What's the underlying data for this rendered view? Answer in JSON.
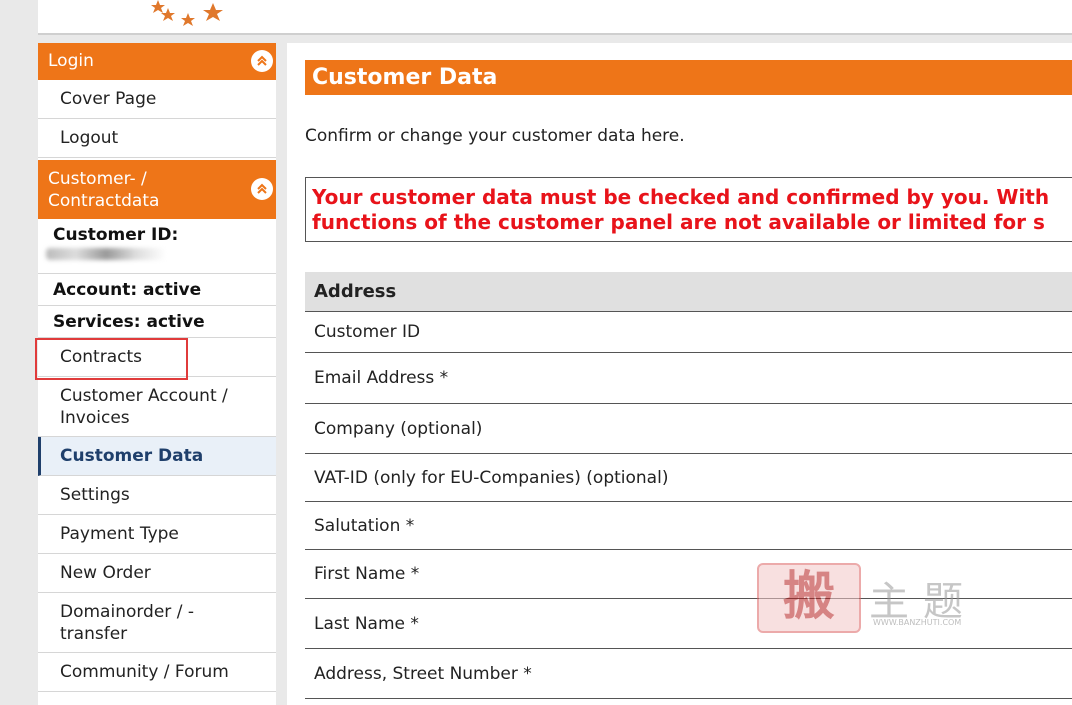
{
  "sidebar": {
    "login_header": "Login",
    "cover_page": "Cover Page",
    "logout": "Logout",
    "customer_header_line1": "Customer- /",
    "customer_header_line2": "Contractdata",
    "customer_id_label": "Customer ID:",
    "account_status": "Account: active",
    "services_status": "Services: active",
    "items": [
      {
        "line1": "Contracts",
        "line2": ""
      },
      {
        "line1": "Customer Account /",
        "line2": "Invoices"
      },
      {
        "line1": "Customer Data",
        "line2": ""
      },
      {
        "line1": "Settings",
        "line2": ""
      },
      {
        "line1": "Payment Type",
        "line2": ""
      },
      {
        "line1": "New Order",
        "line2": ""
      },
      {
        "line1": "Domainorder / -",
        "line2": "transfer"
      },
      {
        "line1": "Community / Forum",
        "line2": ""
      }
    ]
  },
  "main": {
    "title": "Customer Data",
    "intro": "Confirm or change your customer data here.",
    "alert_line1": "Your customer data must be checked and confirmed by you. With",
    "alert_line2": "functions of the customer panel are not available or limited for s",
    "table_header": "Address",
    "fields": [
      "Customer ID",
      "Email Address *",
      "Company (optional)",
      "VAT-ID (only for EU-Companies) (optional)",
      "Salutation *",
      "First Name *",
      "Last Name *",
      "Address, Street Number *"
    ]
  },
  "watermark": {
    "seal": "搬",
    "text": "主题",
    "url": "WWW.BANZHUTI.COM"
  },
  "colors": {
    "brand_orange": "#ee7518",
    "alert_red": "#e8131a",
    "active_navy": "#1f3f6b",
    "highlight_box": "#e03b3b"
  }
}
